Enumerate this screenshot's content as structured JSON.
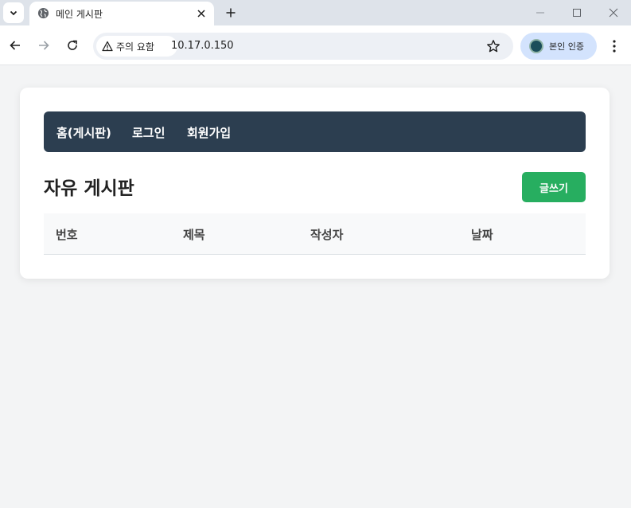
{
  "browser": {
    "tab": {
      "title": "메인 게시판"
    },
    "address_bar": {
      "security_label": "주의 요함",
      "url": "10.17.0.150"
    },
    "profile": {
      "label": "본인 인증"
    },
    "icons": [
      "tab-list-icon",
      "globe-icon",
      "close-icon",
      "plus-icon",
      "minimize-icon",
      "maximize-icon",
      "window-close-icon",
      "back-arrow-icon",
      "forward-arrow-icon",
      "reload-icon",
      "warning-icon",
      "star-icon",
      "more-vert-icon"
    ]
  },
  "page": {
    "nav": {
      "items": [
        {
          "label": "홈(게시판)"
        },
        {
          "label": "로그인"
        },
        {
          "label": "회원가입"
        }
      ],
      "background": "#2c3e50"
    },
    "board": {
      "title": "자유 게시판",
      "write_button": "글쓰기",
      "write_button_color": "#27ae60"
    },
    "table": {
      "columns": [
        "번호",
        "제목",
        "작성자",
        "날짜"
      ],
      "rows": []
    }
  }
}
